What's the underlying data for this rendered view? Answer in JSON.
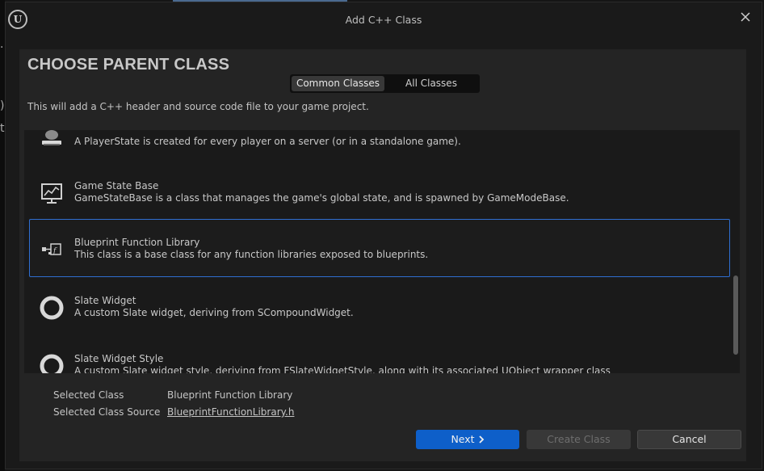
{
  "window": {
    "title": "Add C++ Class",
    "logo_text": "U"
  },
  "heading": "CHOOSE PARENT CLASS",
  "tabs": [
    {
      "label": "Common Classes",
      "active": true
    },
    {
      "label": "All Classes",
      "active": false
    }
  ],
  "description": "This will add a C++ header and source code file to your game project.",
  "classes": [
    {
      "name": "",
      "desc": "A PlayerState is created for every player on a server (or in a standalone game).",
      "icon": "player-state-icon",
      "selected": false
    },
    {
      "name": "Game State Base",
      "desc": "GameStateBase is a class that manages the game's global state, and is spawned by GameModeBase.",
      "icon": "game-state-icon",
      "selected": false
    },
    {
      "name": "Blueprint Function Library",
      "desc": "This class is a base class for any function libraries exposed to blueprints.",
      "icon": "function-library-icon",
      "selected": true
    },
    {
      "name": "Slate Widget",
      "desc": "A custom Slate widget, deriving from SCompoundWidget.",
      "icon": "slate-widget-icon",
      "selected": false
    },
    {
      "name": "Slate Widget Style",
      "desc": "A custom Slate widget style, deriving from FSlateWidgetStyle, along with its associated UObject wrapper class",
      "icon": "slate-widget-style-icon",
      "selected": false
    }
  ],
  "selected_info": {
    "class_label": "Selected Class",
    "class_value": "Blueprint Function Library",
    "source_label": "Selected Class Source",
    "source_value": "BlueprintFunctionLibrary.h"
  },
  "buttons": {
    "next": "Next",
    "create": "Create Class",
    "cancel": "Cancel"
  },
  "colors": {
    "accent": "#0e5fc9",
    "selection_border": "#2f6ed1",
    "panel_bg": "#242424",
    "window_bg": "#1a1a1a"
  }
}
